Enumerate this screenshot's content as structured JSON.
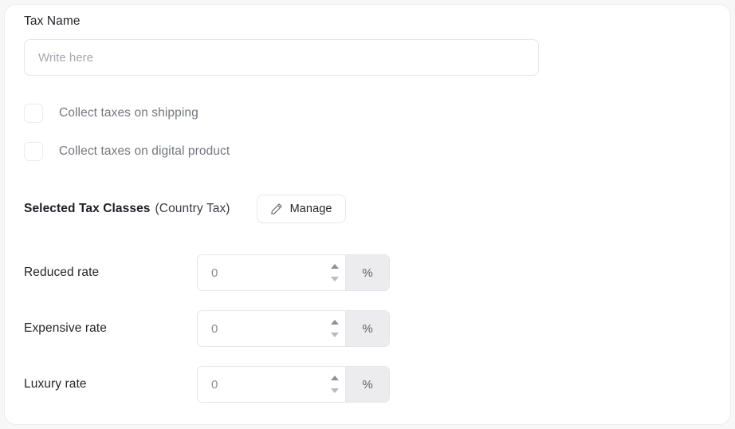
{
  "form": {
    "tax_name": {
      "label": "Tax Name",
      "value": "",
      "placeholder": "Write here"
    },
    "checkboxes": [
      {
        "label": "Collect taxes on shipping",
        "checked": false
      },
      {
        "label": "Collect taxes on digital product",
        "checked": false
      }
    ],
    "tax_classes": {
      "title": "Selected Tax Classes",
      "subtitle": "(Country Tax)",
      "manage_button": {
        "label": "Manage",
        "icon": "pencil-icon"
      }
    },
    "rates": [
      {
        "label": "Reduced rate",
        "value": "",
        "placeholder": "0",
        "suffix": "%"
      },
      {
        "label": "Expensive rate",
        "value": "",
        "placeholder": "0",
        "suffix": "%"
      },
      {
        "label": "Luxury rate",
        "value": "",
        "placeholder": "0",
        "suffix": "%"
      }
    ]
  },
  "colors": {
    "card_background": "#ffffff",
    "border": "#e4e6ea",
    "text_primary": "#24262b",
    "text_muted": "#74777e",
    "suffix_background": "#ececee"
  }
}
